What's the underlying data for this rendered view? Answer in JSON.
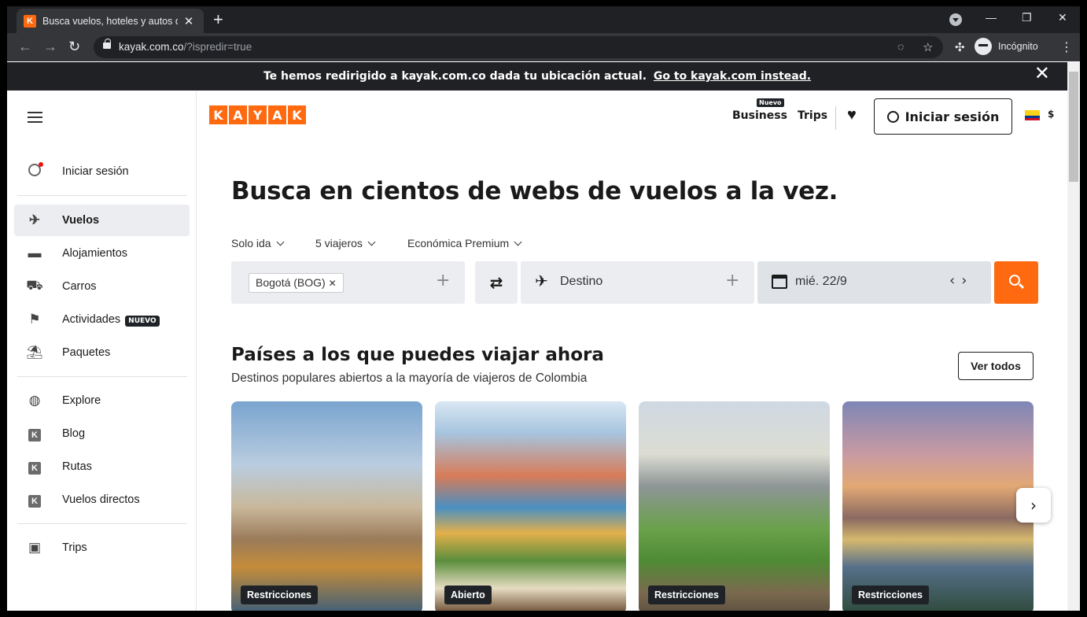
{
  "browser": {
    "tab_title": "Busca vuelos, hoteles y autos de",
    "tab_favicon_letter": "K",
    "url_domain": "kayak.com.co",
    "url_path": "/?ispredir=true",
    "profile_label": "Incógnito"
  },
  "banner": {
    "text": "Te hemos redirigido a kayak.com.co dada tu ubicación actual.",
    "link": "Go to kayak.com instead."
  },
  "sidebar": {
    "signin": "Iniciar sesión",
    "items": [
      {
        "label": "Vuelos",
        "icon": "plane-icon"
      },
      {
        "label": "Alojamientos",
        "icon": "bed-icon"
      },
      {
        "label": "Carros",
        "icon": "car-icon"
      },
      {
        "label": "Actividades",
        "icon": "signpost-icon"
      },
      {
        "label": "Paquetes",
        "icon": "beach-icon"
      }
    ],
    "nuevo_badge": "NUEVO",
    "links": [
      {
        "label": "Explore",
        "icon": "globe-icon"
      },
      {
        "label": "Blog",
        "icon": "kayak-k-icon"
      },
      {
        "label": "Rutas",
        "icon": "kayak-k-icon"
      },
      {
        "label": "Vuelos directos",
        "icon": "kayak-k-icon"
      }
    ],
    "trips": "Trips"
  },
  "header": {
    "logo_letters": [
      "K",
      "A",
      "Y",
      "A",
      "K"
    ],
    "business": "Business",
    "business_badge": "Nuevo",
    "trips": "Trips",
    "signin": "Iniciar sesión",
    "currency": "$"
  },
  "search": {
    "headline": "Busca en cientos de webs de vuelos a la vez.",
    "trip_type": "Solo ida",
    "travelers": "5 viajeros",
    "cabin": "Económica Premium",
    "origin_chip": "Bogotá (BOG)",
    "destination_placeholder": "Destino",
    "date": "mié. 22/9"
  },
  "section": {
    "title": "Países a los que puedes viajar ahora",
    "subtitle": "Destinos populares abiertos a la mayoría de viajeros de Colombia",
    "see_all": "Ver todos",
    "cards": [
      {
        "badge": "Restricciones"
      },
      {
        "badge": "Abierto"
      },
      {
        "badge": "Restricciones"
      },
      {
        "badge": "Restricciones"
      }
    ]
  },
  "colors": {
    "brand": "#ff690f",
    "dark": "#1a1a1a",
    "field_bg": "#ebedf0"
  }
}
